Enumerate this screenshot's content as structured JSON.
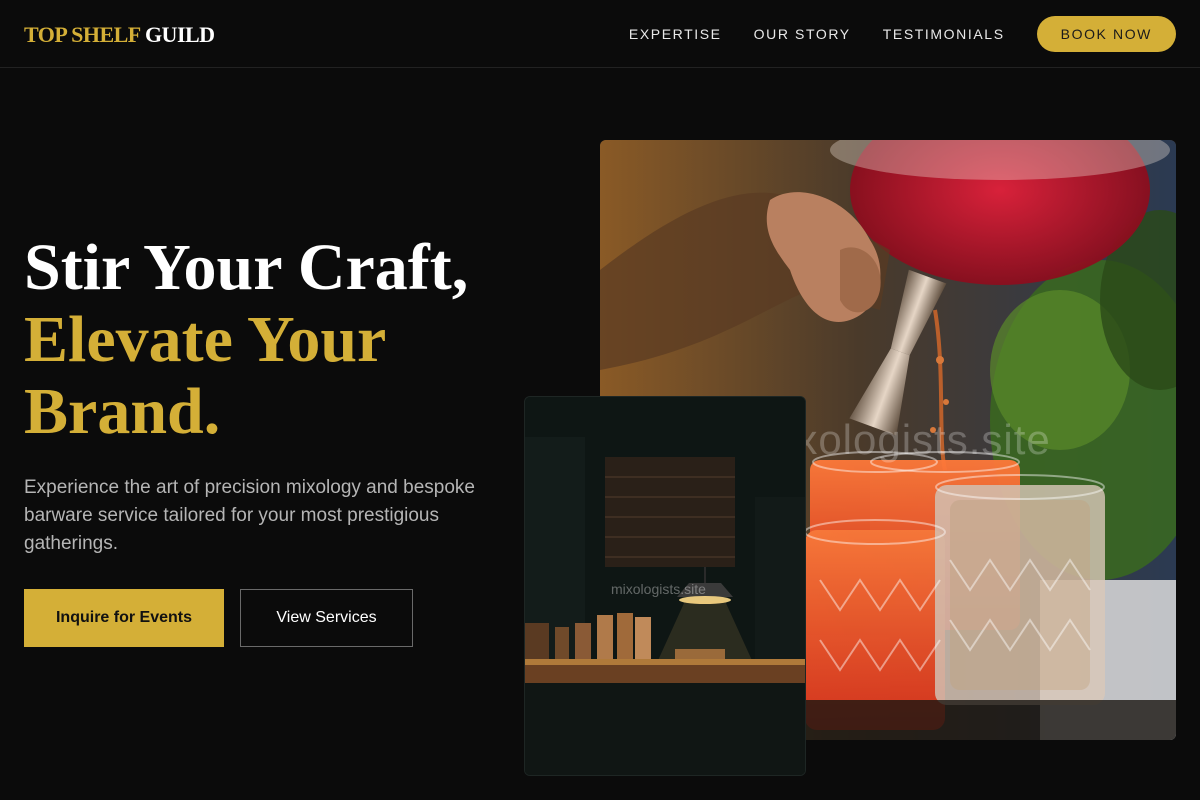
{
  "brand": {
    "name_gold": "TOP SHELF",
    "name_white": "GUILD"
  },
  "nav": {
    "links": [
      "EXPERTISE",
      "OUR STORY",
      "TESTIMONIALS"
    ],
    "book_label": "BOOK NOW"
  },
  "hero": {
    "headline_line1": "Stir Your Craft,",
    "headline_line2": "Elevate Your",
    "headline_line3": "Brand.",
    "subtext": "Experience the art of precision mixology and bespoke barware service tailored for your most prestigious gatherings.",
    "cta_primary": "Inquire for Events",
    "cta_secondary": "View Services"
  },
  "images": {
    "main_watermark": "mixologists.site",
    "inset_watermark": "mixologists.site"
  },
  "colors": {
    "accent": "#d4af37",
    "background": "#0b0b0b"
  }
}
